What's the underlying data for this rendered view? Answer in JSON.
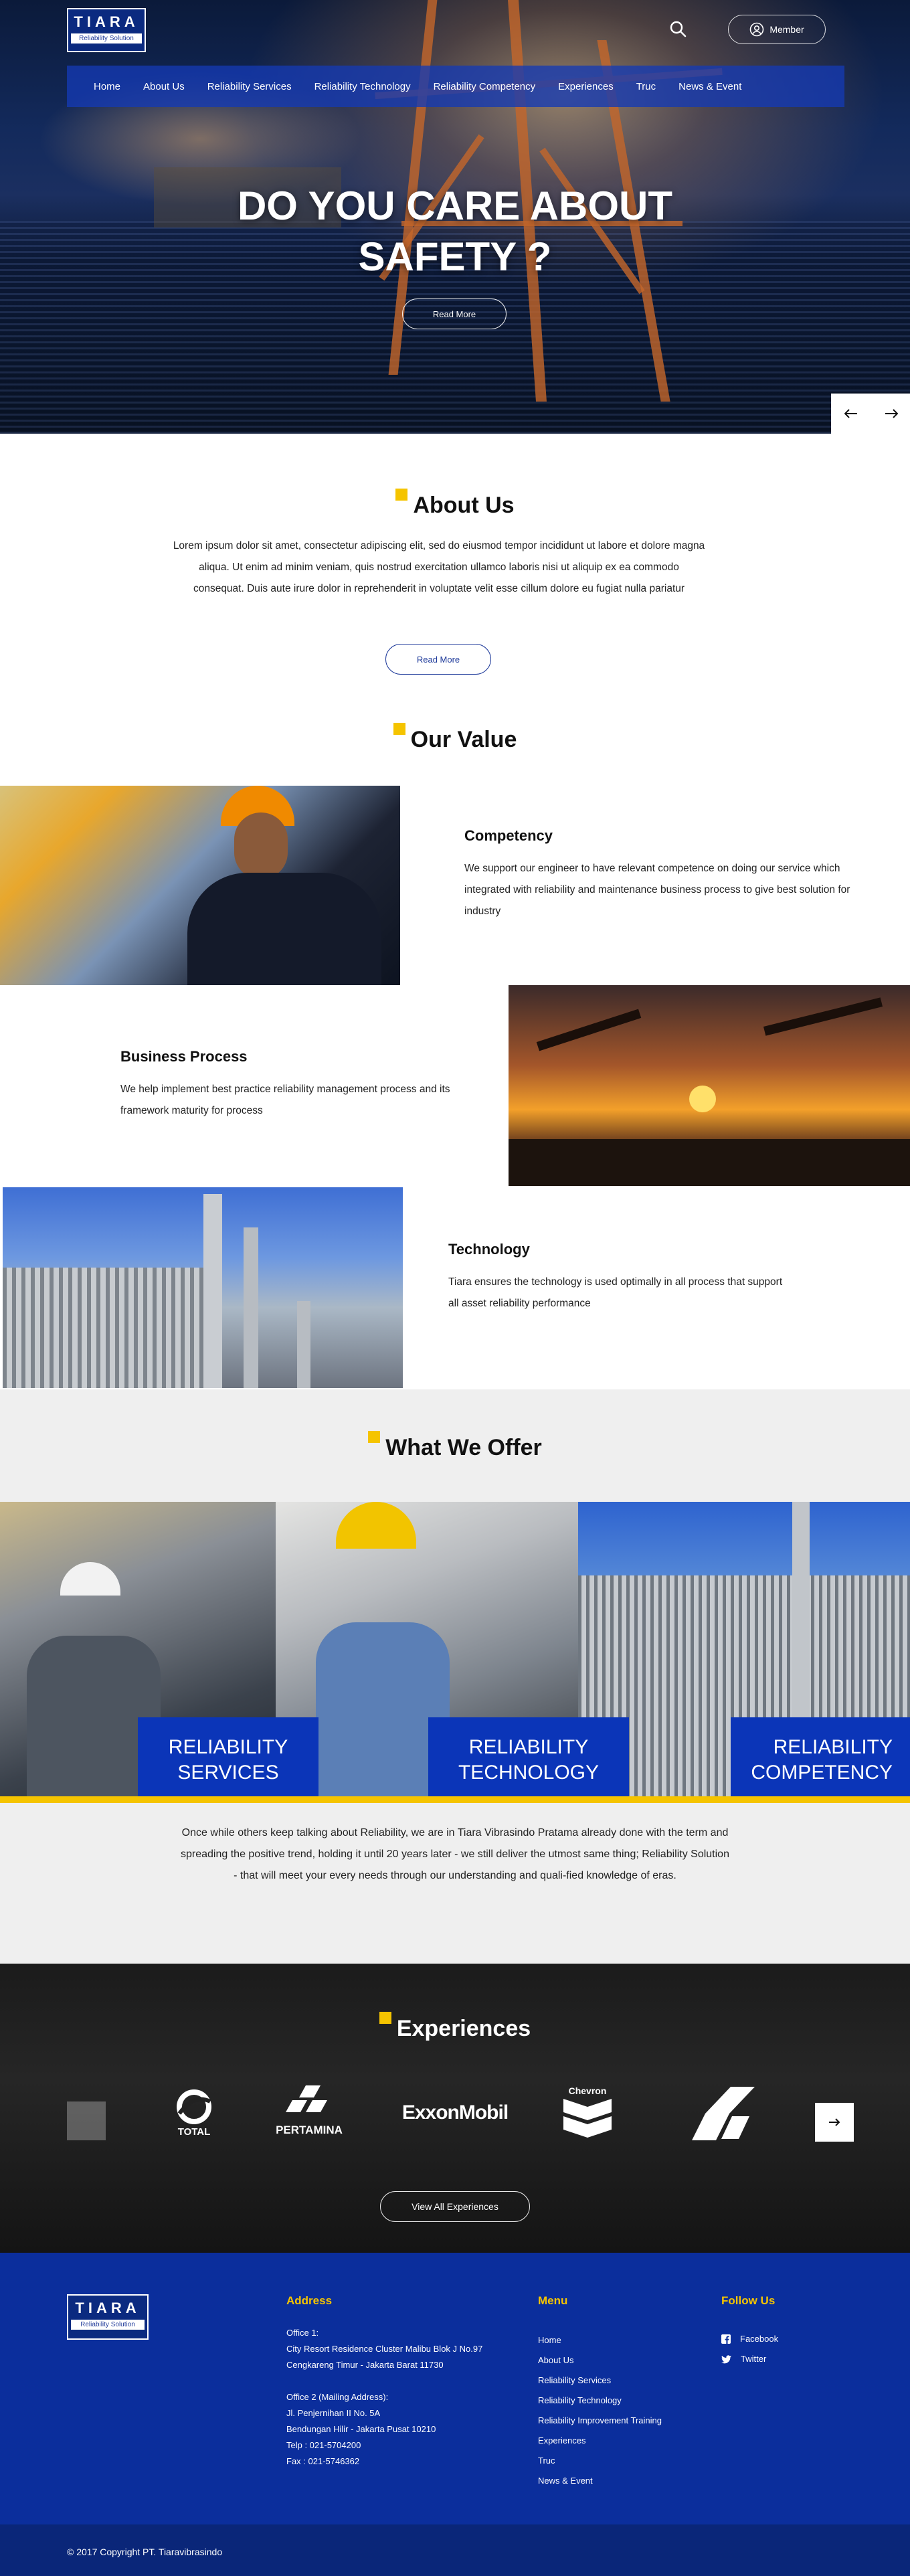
{
  "brand": {
    "name": "TIARA",
    "tagline": "Reliability Solution"
  },
  "header": {
    "member_label": "Member"
  },
  "nav": [
    "Home",
    "About Us",
    "Reliability Services",
    "Reliability  Technology",
    "Reliability Competency",
    "Experiences",
    "Truc",
    "News & Event"
  ],
  "hero": {
    "title_line1": "DO YOU CARE ABOUT",
    "title_line2": "SAFETY ?",
    "button": "Read More"
  },
  "about": {
    "title": "About Us",
    "text": "Lorem ipsum dolor sit amet, consectetur adipiscing elit, sed do eiusmod tempor incididunt ut labore et dolore magna aliqua. Ut enim ad minim veniam, quis nostrud exercitation ullamco laboris nisi ut aliquip ex ea commodo consequat. Duis aute irure dolor in reprehenderit in voluptate velit esse cillum dolore eu fugiat nulla pariatur",
    "button": "Read More"
  },
  "values": {
    "title": "Our Value",
    "items": [
      {
        "title": "Competency",
        "text": "We support our engineer to have relevant competence on doing our service which integrated with reliability and maintenance business process to give best solution for industry"
      },
      {
        "title": "Business Process",
        "text": "We help implement best practice reliability management process and its framework maturity for process"
      },
      {
        "title": "Technology",
        "text": "Tiara ensures the technology is used optimally in all process that support all asset reliability performance"
      }
    ]
  },
  "offer": {
    "title": "What We Offer",
    "items": [
      {
        "line1": "RELIABILITY",
        "line2": "SERVICES"
      },
      {
        "line1": "RELIABILITY",
        "line2": "TECHNOLOGY"
      },
      {
        "line1": "RELIABILITY",
        "line2": "COMPETENCY"
      }
    ],
    "text": "Once while others keep talking about Reliability, we are in Tiara Vibrasindo Pratama already done with the term and spreading the positive trend, holding it until 20 years later - we still deliver the utmost same thing; Reliability Solution - that will meet your every needs through our understanding and quali-fied knowledge of eras."
  },
  "experiences": {
    "title": "Experiences",
    "clients": [
      "TOTAL",
      "PERTAMINA",
      "ExxonMobil",
      "Chevron"
    ],
    "button": "View All Experiences"
  },
  "footer": {
    "address_title": "Address",
    "office1_label": "Office 1:",
    "office1_line1": "City Resort Residence Cluster Malibu Blok J No.97",
    "office1_line2": "Cengkareng Timur - Jakarta Barat 11730",
    "office2_label": "Office 2 (Mailing Address):",
    "office2_line1": "Jl. Penjernihan II No. 5A",
    "office2_line2": "Bendungan Hilir - Jakarta Pusat 10210",
    "phone": "Telp : 021-5704200",
    "fax": "Fax : 021-5746362",
    "menu_title": "Menu",
    "menu": [
      "Home",
      "About Us",
      "Reliability Services",
      "Reliability  Technology",
      "Reliability Improvement Training",
      "Experiences",
      "Truc",
      "News & Event"
    ],
    "follow_title": "Follow Us",
    "social": [
      "Facebook",
      "Twitter"
    ],
    "copyright": "© 2017 Copyright  PT. Tiaravibrasindo"
  },
  "colors": {
    "primary": "#0b2e9c",
    "accent": "#f5c400"
  },
  "icons": [
    "search-icon",
    "user-circle-icon",
    "arrow-left-icon",
    "arrow-right-icon",
    "facebook-icon",
    "twitter-icon"
  ]
}
